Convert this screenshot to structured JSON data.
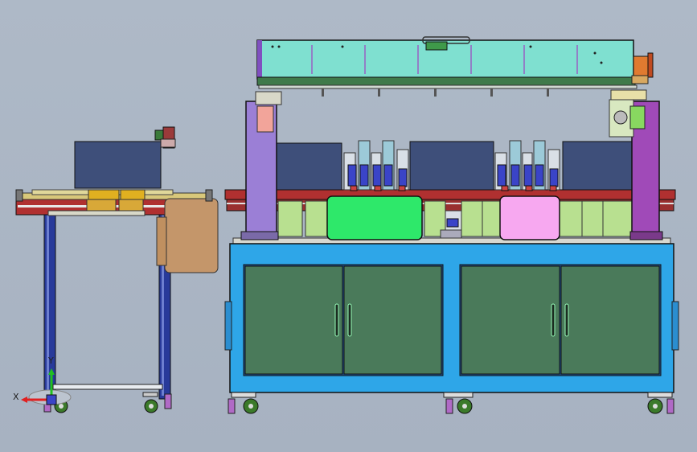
{
  "viewport": {
    "background": "#abb6c4"
  },
  "triad": {
    "x_label": "X",
    "y_label": "Y",
    "x_color": "#e02020",
    "y_color": "#20c020"
  },
  "colors": {
    "cabinet_frame": "#2ea6e8",
    "cabinet_door": "#4a7a5a",
    "cover_panel": "#7fe0d0",
    "cover_base": "#3f7a4a",
    "left_post": "#9b7fd6",
    "right_post": "#a04ab8",
    "green_guard": "#2ee86a",
    "pink_guard": "#f7a8f0",
    "conveyor_red": "#b03030",
    "navy_box": "#3e4f7a",
    "tan_panel": "#c4966a",
    "aluminum": "#d9dfe6",
    "yellow_plate": "#d8c87a",
    "frame_blue": "#283a9a"
  }
}
